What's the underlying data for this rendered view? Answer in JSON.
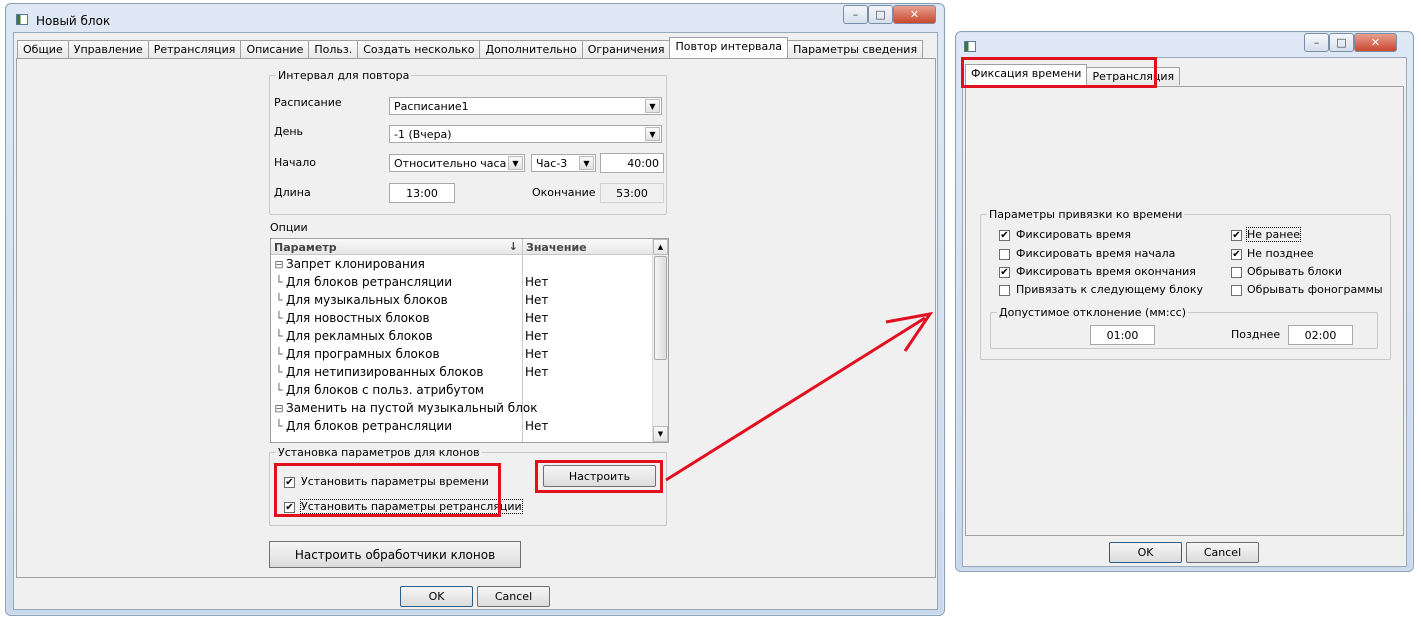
{
  "win1": {
    "title": "Новый блок",
    "tabs": [
      "Общие",
      "Управление",
      "Ретрансляция",
      "Описание",
      "Польз.",
      "Создать несколько",
      "Дополнительно",
      "Ограничения",
      "Повтор интервала",
      "Параметры сведения"
    ],
    "active_tab": 8,
    "interval_group": {
      "title": "Интервал для повтора",
      "schedule_label": "Расписание",
      "schedule_value": "Расписание1",
      "day_label": "День",
      "day_value": "-1 (Вчера)",
      "start_label": "Начало",
      "start_mode": "Относительно часа",
      "start_hour": "Час-3",
      "start_time": "40:00",
      "length_label": "Длина",
      "length_value": "13:00",
      "end_label": "Окончание",
      "end_value": "53:00"
    },
    "options": {
      "title": "Опции",
      "col_param": "Параметр",
      "col_value": "Значение",
      "rows": [
        {
          "name": "Запрет клонирования",
          "value": "",
          "group": true
        },
        {
          "name": "Для блоков ретрансляции",
          "value": "Нет",
          "group": false
        },
        {
          "name": "Для музыкальных блоков",
          "value": "Нет",
          "group": false
        },
        {
          "name": "Для новостных блоков",
          "value": "Нет",
          "group": false
        },
        {
          "name": "Для рекламных блоков",
          "value": "Нет",
          "group": false
        },
        {
          "name": "Для програмных блоков",
          "value": "Нет",
          "group": false
        },
        {
          "name": "Для нетипизированных блоков",
          "value": "Нет",
          "group": false
        },
        {
          "name": "Для блоков с польз. атрибутом",
          "value": "",
          "group": false
        },
        {
          "name": "Заменить на пустой музыкальный блок",
          "value": "",
          "group": true
        },
        {
          "name": "Для блоков ретрансляции",
          "value": "Нет",
          "group": false
        }
      ]
    },
    "clone_group": {
      "title": "Установка параметров для клонов",
      "set_time_label": "Установить параметры времени",
      "set_time_checked": true,
      "set_retrans_label": "Установить параметры ретрансляции",
      "set_retrans_checked": true,
      "configure_button": "Настроить"
    },
    "handlers_button": "Настроить обработчики клонов",
    "ok": "OK",
    "cancel": "Cancel"
  },
  "win2": {
    "title": "",
    "tabs": [
      "Фиксация времени",
      "Ретрансляция"
    ],
    "active_tab": 0,
    "binding_group": {
      "title": "Параметры привязки ко времени",
      "checks": [
        {
          "label": "Фиксировать время",
          "checked": true
        },
        {
          "label": "Фиксировать время начала",
          "checked": false
        },
        {
          "label": "Фиксировать время окончания",
          "checked": true
        },
        {
          "label": "Привязать к следующему блоку",
          "checked": false
        }
      ],
      "checks_right": [
        {
          "label": "Не ранее",
          "checked": true
        },
        {
          "label": "Не позднее",
          "checked": true
        },
        {
          "label": "Обрывать блоки",
          "checked": false
        },
        {
          "label": "Обрывать фонограммы",
          "checked": false
        }
      ],
      "deviation": {
        "title": "Допустимое отклонение (мм:сс)",
        "early_value": "01:00",
        "late_label": "Позднее",
        "late_value": "02:00"
      }
    },
    "ok": "OK",
    "cancel": "Cancel"
  },
  "colors": {
    "highlight": "#e01020",
    "arrow": "#e01020"
  }
}
